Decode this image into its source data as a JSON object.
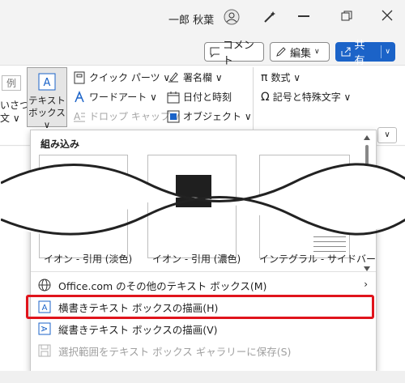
{
  "titlebar": {
    "user_name": "一郎 秋葉"
  },
  "cmdbar": {
    "comment": "コメント",
    "edit": "編集",
    "share": "共有"
  },
  "ribbon": {
    "partial_left_1": "例",
    "partial_left_2": "いさつ",
    "partial_left_3": "文 ∨",
    "textbox_1": "テキスト",
    "textbox_2": "ボックス ∨",
    "quick_parts": "クイック パーツ ∨",
    "wordart": "ワードアート ∨",
    "dropcap": "ドロップ キャップ ∨",
    "signature": "署名欄 ∨",
    "datetime": "日付と時刻",
    "object": "オブジェクト ∨",
    "equation": "数式 ∨",
    "symbol": "記号と特殊文字 ∨"
  },
  "gallery": {
    "title": "組み込み",
    "captions": [
      "イオン - 引用 (淡色)",
      "イオン - 引用 (濃色)",
      "インテグラル - サイドバー"
    ]
  },
  "menu": [
    {
      "label": "Office.com のその他のテキスト ボックス(M)",
      "enabled": true
    },
    {
      "label": "横書きテキスト ボックスの描画(H)",
      "enabled": true
    },
    {
      "label": "縦書きテキスト ボックスの描画(V)",
      "enabled": true
    },
    {
      "label": "選択範囲をテキスト ボックス ギャラリーに保存(S)",
      "enabled": false
    }
  ],
  "colors": {
    "accent": "#1b63c8",
    "highlight": "#e0141c"
  }
}
